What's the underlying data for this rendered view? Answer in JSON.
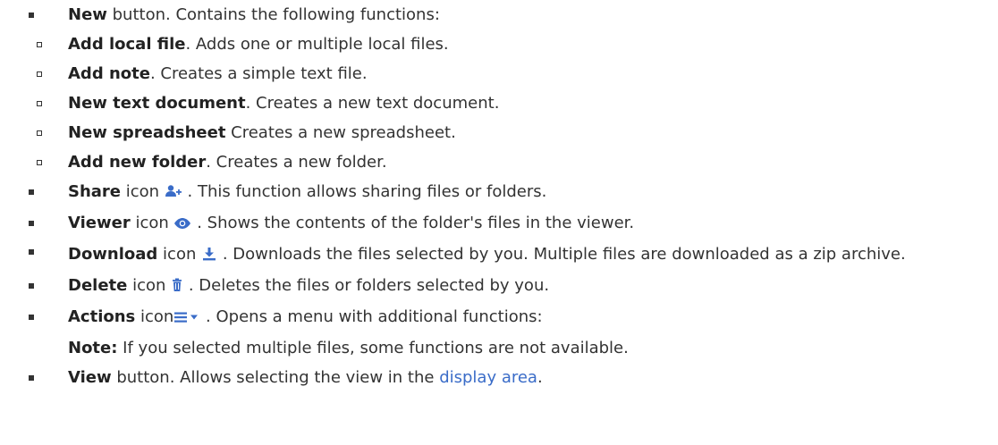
{
  "items": [
    {
      "bold": "New",
      "text": " button. Contains the following functions:"
    },
    {
      "bold": "Share",
      "pre_icon": " icon ",
      "post_icon": " . This function allows sharing files or folders."
    },
    {
      "bold": "Viewer",
      "pre_icon": " icon ",
      "post_icon": " . Shows the contents of the folder's files in the viewer."
    },
    {
      "bold": "Download",
      "pre_icon": " icon ",
      "post_icon": " . Downloads the files selected by you. Multiple files are downloaded as a zip archive."
    },
    {
      "bold": "Delete",
      "pre_icon": " icon ",
      "post_icon": " . Deletes the files or folders selected by you."
    },
    {
      "bold": "Actions",
      "pre_icon": " icon",
      "post_icon": " . Opens a menu with additional functions:",
      "note_bold": "Note:",
      "note_text": " If you selected multiple files, some functions are not available."
    },
    {
      "bold": "View",
      "pre_link": " button. Allows selecting the view in the ",
      "link": "display area",
      "post_link": "."
    }
  ],
  "new_subitems": [
    {
      "bold": "Add local file",
      "text": ". Adds one or multiple local files."
    },
    {
      "bold": "Add note",
      "text": ". Creates a simple text file."
    },
    {
      "bold": "New text document",
      "text": ". Creates a new text document."
    },
    {
      "bold": "New spreadsheet",
      "text": " Creates a new spreadsheet."
    },
    {
      "bold": "Add new folder",
      "text": ". Creates a new folder."
    }
  ],
  "icons": {
    "share": "share-user-icon",
    "viewer": "eye-icon",
    "download": "download-icon",
    "delete": "trash-icon",
    "actions": "menu-icon"
  },
  "colors": {
    "icon": "#3a6cc8",
    "link": "#3a6cc8",
    "text": "#333333"
  }
}
